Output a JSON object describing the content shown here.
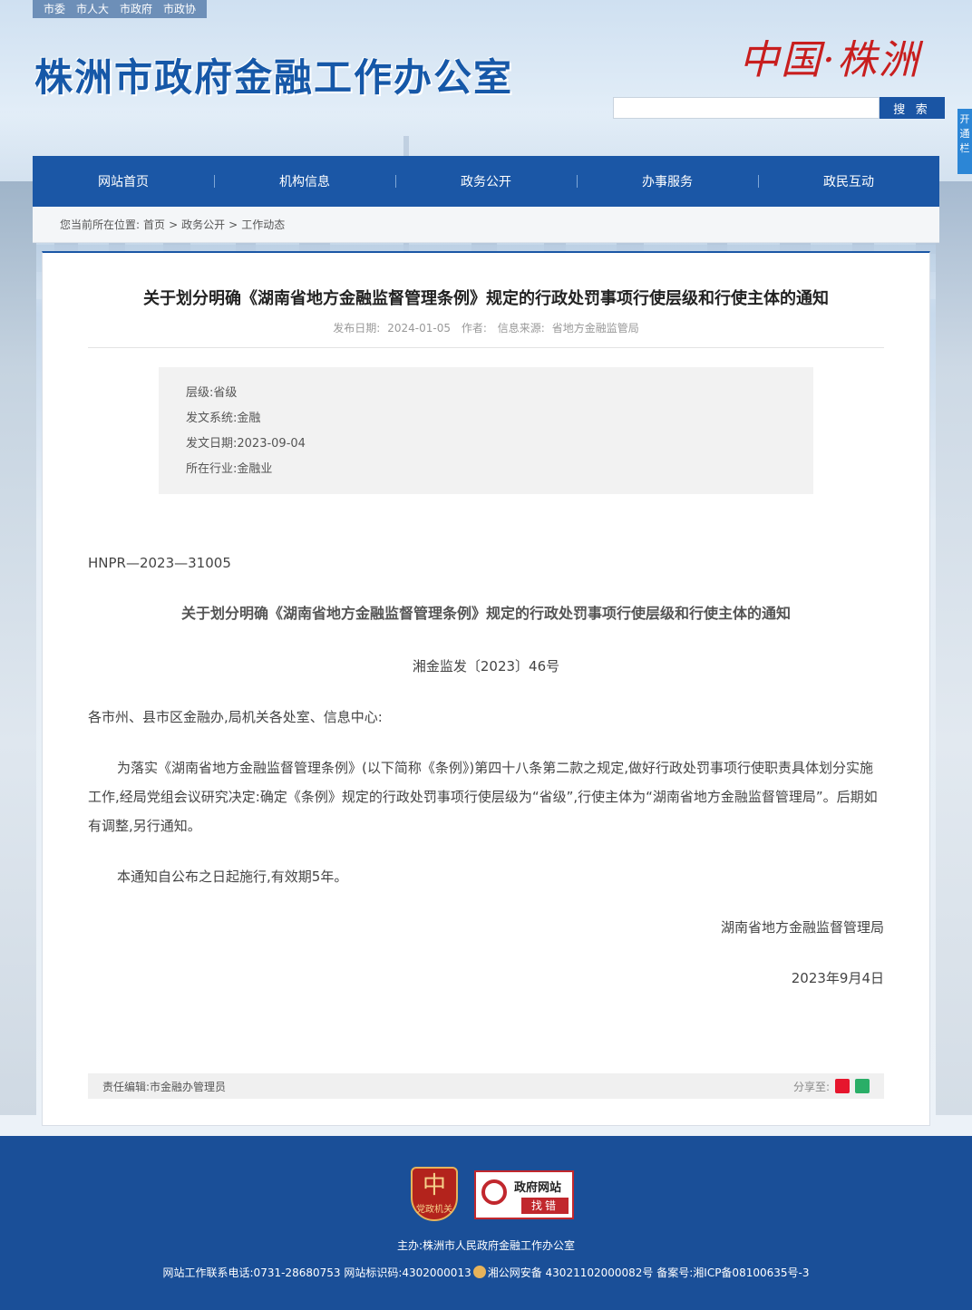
{
  "top_links": [
    "市委",
    "市人大",
    "市政府",
    "市政协"
  ],
  "site_title": "株洲市政府金融工作办公室",
  "city_logo": "中国·株洲",
  "search": {
    "placeholder": "",
    "button": "搜 索"
  },
  "side_tab": "开通栏",
  "nav": [
    "网站首页",
    "机构信息",
    "政务公开",
    "办事服务",
    "政民互动"
  ],
  "breadcrumb": {
    "prefix": "您当前所在位置:",
    "items": [
      "首页",
      "政务公开",
      "工作动态"
    ],
    "sep": ">"
  },
  "article": {
    "title": "关于划分明确《湖南省地方金融监督管理条例》规定的行政处罚事项行使层级和行使主体的通知",
    "meta": {
      "date_label": "发布日期:",
      "date": "2024-01-05",
      "author_label": "作者:",
      "source_label": "信息来源:",
      "source": "省地方金融监管局"
    },
    "info": [
      {
        "label": "层级:",
        "value": "省级"
      },
      {
        "label": "发文系统:",
        "value": "金融"
      },
      {
        "label": "发文日期:",
        "value": "2023-09-04"
      },
      {
        "label": "所在行业:",
        "value": "金融业"
      }
    ],
    "doc_number": "HNPR—2023—31005",
    "doc_title": "关于划分明确《湖南省地方金融监督管理条例》规定的行政处罚事项行使层级和行使主体的通知",
    "doc_code": "湘金监发〔2023〕46号",
    "salutation": "各市州、县市区金融办,局机关各处室、信息中心:",
    "para1": "为落实《湖南省地方金融监督管理条例》(以下简称《条例》)第四十八条第二款之规定,做好行政处罚事项行使职责具体划分实施工作,经局党组会议研究决定:确定《条例》规定的行政处罚事项行使层级为“省级”,行使主体为“湖南省地方金融监督管理局”。后期如有调整,另行通知。",
    "para2": "本通知自公布之日起施行,有效期5年。",
    "signature": "湖南省地方金融监督管理局",
    "sign_date": "2023年9月4日",
    "editor": "责任编辑:市金融办管理员",
    "share_label": "分享至:"
  },
  "footer": {
    "party_badge": "党政机关",
    "error_badge_title": "政府网站",
    "error_badge_btn": "找错",
    "host": "主办:株洲市人民政府金融工作办公室",
    "contact_part1": "网站工作联系电话:0731-28680753 网站标识码:4302000013",
    "contact_part2": "湘公网安备 43021102000082号 备案号:湘ICP备08100635号-3"
  }
}
